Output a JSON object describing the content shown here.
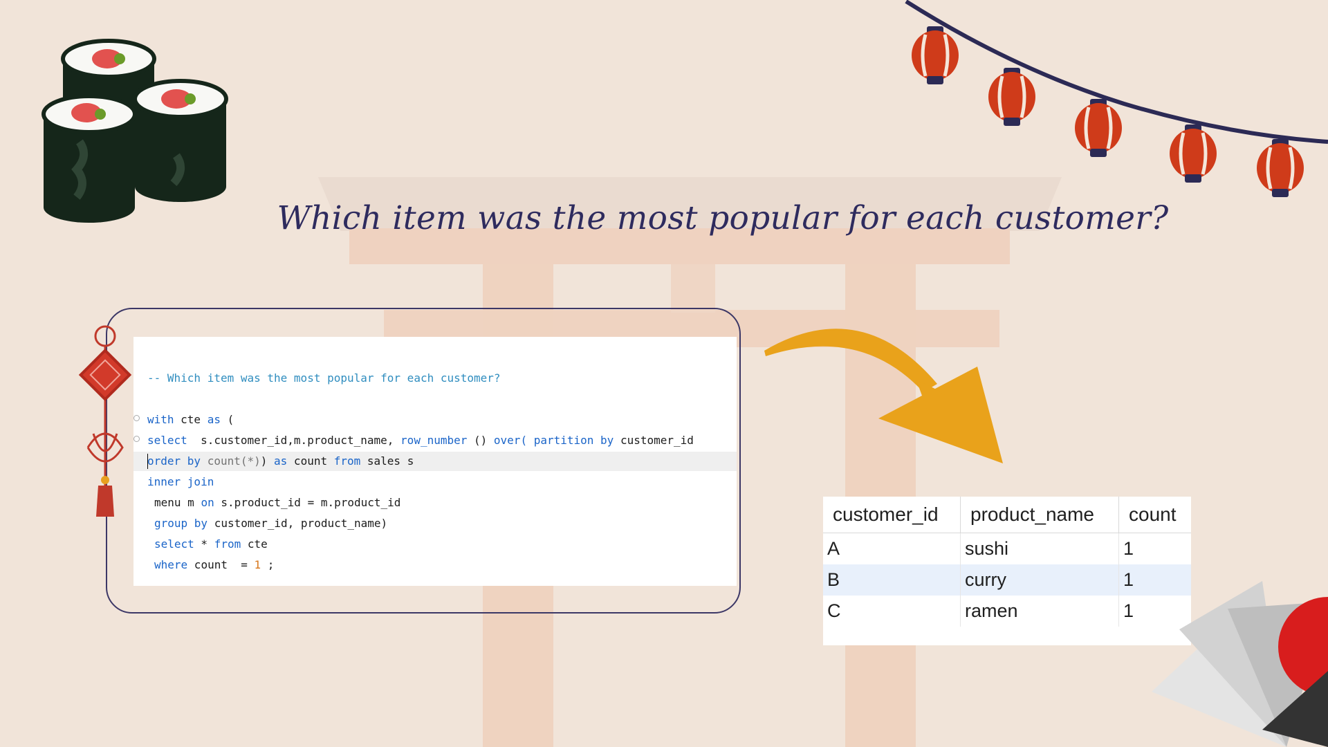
{
  "title": "Which item was the most popular for each customer?",
  "code": {
    "comment": "-- Which item was the most popular for each customer?",
    "lines": {
      "l1_kw1": "with",
      "l1_t1": " cte ",
      "l1_kw2": "as",
      "l1_t2": " (",
      "l2_kw1": "select",
      "l2_t1": "  s.customer_id,m.product_name, ",
      "l2_kw2": "row_number",
      "l2_t2": " () ",
      "l2_kw3": "over(",
      "l2_t3": " ",
      "l2_kw4": "partition by",
      "l2_t4": " customer_id",
      "l3_kw1": "order by",
      "l3_t0": " ",
      "l3_fn1": "count(*)",
      "l3_t1": ") ",
      "l3_kw2": "as",
      "l3_t2": " count ",
      "l3_kw3": "from",
      "l3_t3": " sales s",
      "l4_kw1": "inner join",
      "l5_t1": "menu m ",
      "l5_kw1": "on",
      "l5_t2": " s.product_id = m.product_id",
      "l6_kw1": "group by",
      "l6_t1": " customer_id, product_name)",
      "l7_kw1": "select",
      "l7_t1": " * ",
      "l7_kw2": "from",
      "l7_t2": " cte",
      "l8_kw1": "where",
      "l8_t1": " count  = ",
      "l8_num": "1",
      "l8_t2": " ;"
    }
  },
  "result": {
    "columns": [
      "customer_id",
      "product_name",
      "count"
    ],
    "rows": [
      [
        "A",
        "sushi",
        "1"
      ],
      [
        "B",
        "curry",
        "1"
      ],
      [
        "C",
        "ramen",
        "1"
      ]
    ],
    "selected_row": 1
  },
  "colors": {
    "background": "#f1e4d9",
    "title": "#2e2b5e",
    "keyword": "#1a64c8",
    "comment": "#2f8dbf",
    "arrow": "#e9a21b",
    "lantern": "#cf3b1a",
    "frame": "#3c3766"
  },
  "icons": [
    "sushi-roll-icon",
    "lantern-string-icon",
    "chinese-knot-icon",
    "curved-arrow-icon",
    "paper-fan-icon",
    "torii-gate-icon"
  ]
}
